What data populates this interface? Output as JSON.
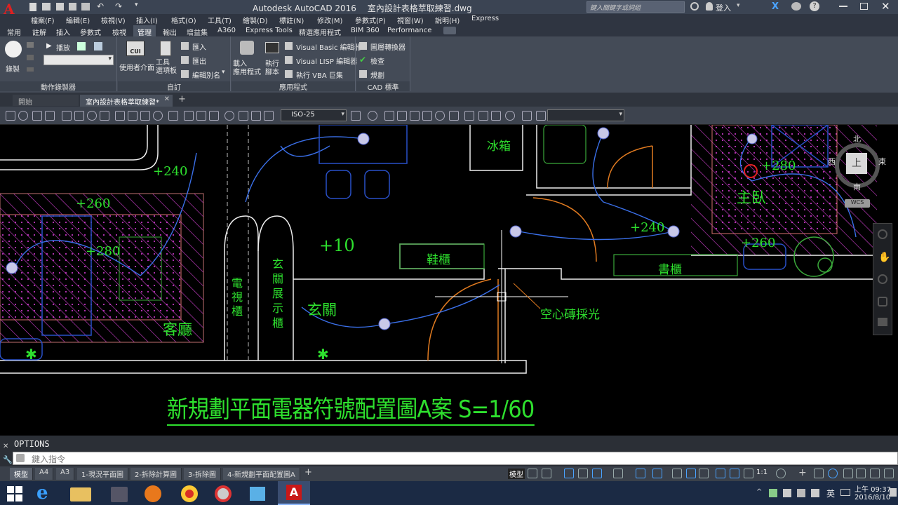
{
  "app": {
    "title": "Autodesk AutoCAD 2016",
    "document": "室內設計表格萃取練習.dwg",
    "search_placeholder": "鍵入關鍵字或詞組",
    "login": "登入",
    "app_menu_letter": "A"
  },
  "menubar": [
    "檔案(F)",
    "編輯(E)",
    "檢視(V)",
    "插入(I)",
    "格式(O)",
    "工具(T)",
    "繪製(D)",
    "標註(N)",
    "修改(M)",
    "參數式(P)",
    "視窗(W)",
    "說明(H)",
    "Express"
  ],
  "ribbon_tabs": [
    "常用",
    "註解",
    "插入",
    "參數式",
    "檢視",
    "管理",
    "輸出",
    "增益集",
    "A360",
    "Express Tools",
    "精選應用程式",
    "BIM 360",
    "Performance"
  ],
  "ribbon_active_tab": "管理",
  "ribbon": {
    "action_recorder": {
      "record": "錄製",
      "play": "播放",
      "title": "動作錄製器"
    },
    "customize": {
      "cui": "使用者介面",
      "cui_badge": "CUI",
      "tool_palette": "工具\n選項板",
      "import": "匯入",
      "export": "匯出",
      "edit_alias": "編輯別名",
      "title": "自訂"
    },
    "applications": {
      "load": "載入\n應用程式",
      "run": "執行\n腳本",
      "vb": "Visual Basic 編輯器",
      "lisp": "Visual LISP 編輯器",
      "vba": "執行 VBA 巨集",
      "title": "應用程式"
    },
    "cad_standards": {
      "layer_translator": "圖層轉換器",
      "check": "檢查",
      "configure": "規劃",
      "title": "CAD 標準"
    }
  },
  "file_tabs": {
    "start": "開始",
    "active": "室內設計表格萃取練習*"
  },
  "toolbar": {
    "dimstyle": "ISO-25",
    "second_select": ""
  },
  "drawing": {
    "title": "新規劃平面電器符號配置圖A案 S=1/60",
    "labels": {
      "h240a": "+240",
      "h260a": "+260",
      "h280a": "+280",
      "h10": "+10",
      "h240b": "+240",
      "h280b": "+280",
      "h260b": "+260",
      "fridge": "冰箱",
      "master": "主臥",
      "shoe": "鞋櫃",
      "bookcase": "書櫃",
      "tv": "電\n視\n櫃",
      "display": "玄\n關\n展\n示\n櫃",
      "entry": "玄關",
      "living": "客廳",
      "brick": "空心磚採光"
    },
    "viewcube": {
      "n": "北",
      "s": "南",
      "e": "東",
      "w": "西",
      "top": "上",
      "wcs": "WCS"
    },
    "colors": {
      "text": "#2ee02e",
      "wall": "#f0f0f0",
      "wire": "#3a6fe8",
      "door": "#e07a20",
      "hatch": "#d03cd0"
    }
  },
  "command": {
    "history": "OPTIONS",
    "placeholder": "鍵入指令"
  },
  "layout_tabs": [
    "模型",
    "A4",
    "A3",
    "1-現況平面圖",
    "2-拆除計算圖",
    "3-拆除圖",
    "4-新規劃平面配置圖A"
  ],
  "status": {
    "model": "模型",
    "scale": "1:1"
  },
  "tray": {
    "ime": "英",
    "time": "上午 09:37",
    "date": "2016/8/10"
  }
}
